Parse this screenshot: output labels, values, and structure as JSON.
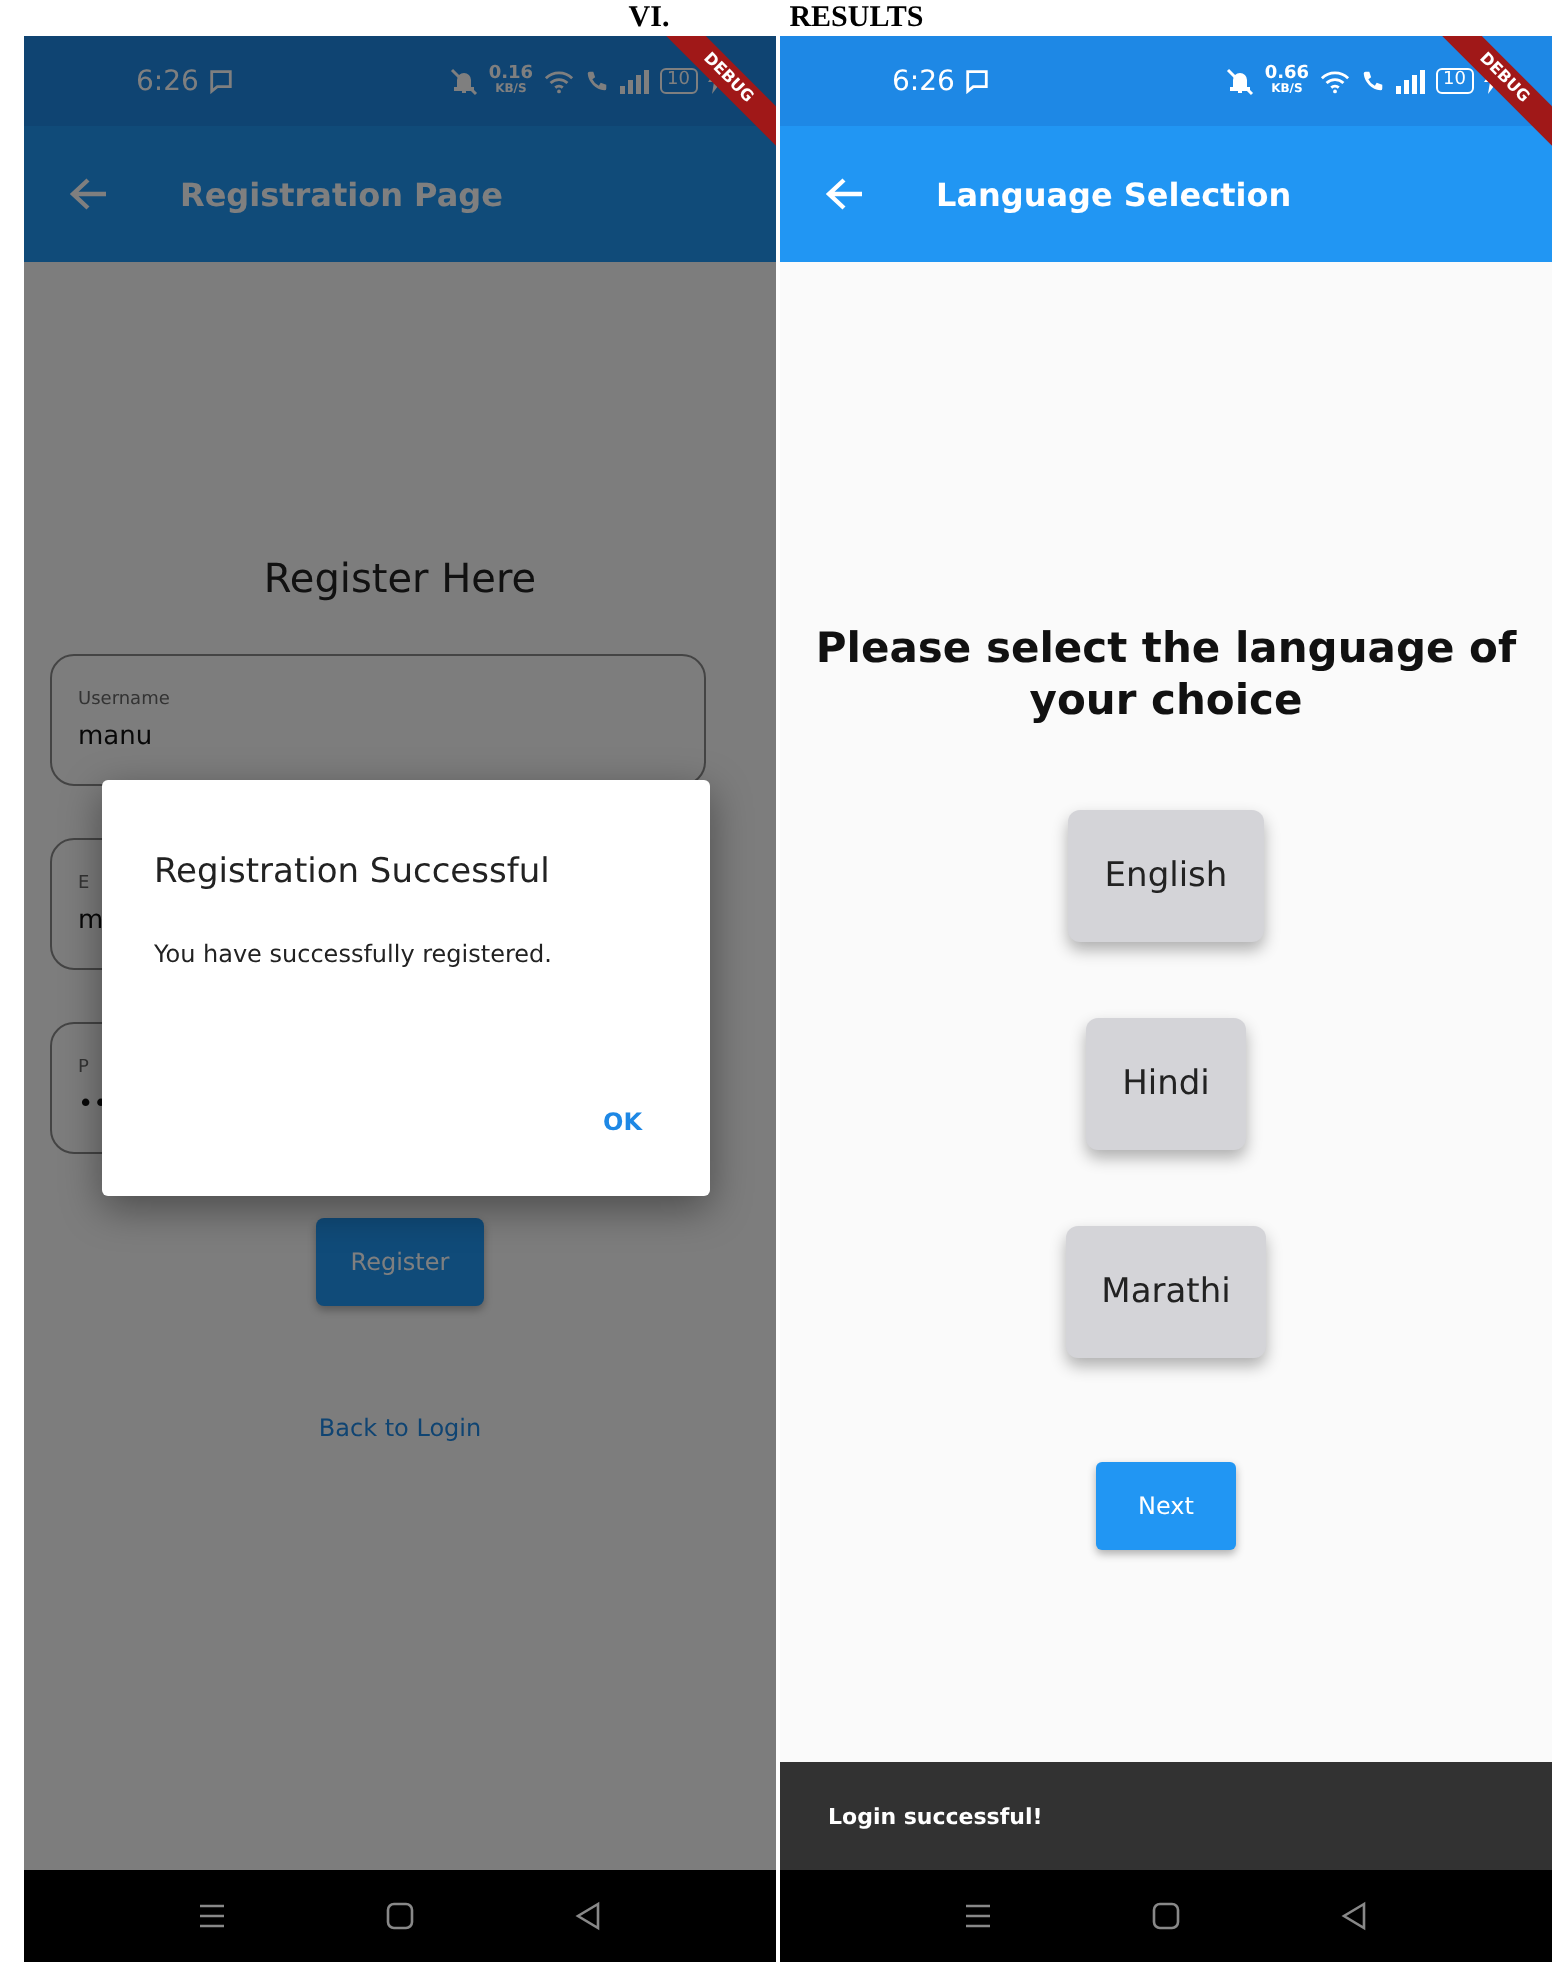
{
  "heading": {
    "number": "VI.",
    "title": "RESULTS"
  },
  "screens": [
    {
      "kind": "registration",
      "dimmed": true,
      "status": {
        "time": "6:26",
        "speed": "0.16",
        "speed_unit": "KB/S",
        "battery": "10"
      },
      "debug_banner": "DEBUG",
      "app_bar": {
        "title": "Registration Page"
      },
      "title": "Register Here",
      "fields": [
        {
          "label": "Username",
          "value": "manu"
        },
        {
          "label": "E",
          "value": "m"
        },
        {
          "label": "P",
          "value": "••"
        }
      ],
      "register_button": "Register",
      "back_link": "Back to Login",
      "dialog": {
        "title": "Registration Successful",
        "message": "You have successfully registered.",
        "action": "OK"
      }
    },
    {
      "kind": "language",
      "dimmed": false,
      "status": {
        "time": "6:26",
        "speed": "0.66",
        "speed_unit": "KB/S",
        "battery": "10"
      },
      "debug_banner": "DEBUG",
      "app_bar": {
        "title": "Language Selection"
      },
      "prompt": "Please select the language of your choice",
      "languages": [
        "English",
        "Hindi",
        "Marathi"
      ],
      "next_button": "Next",
      "snackbar": "Login successful!"
    }
  ]
}
